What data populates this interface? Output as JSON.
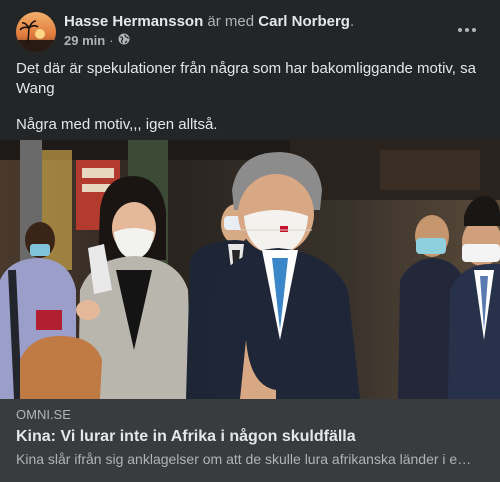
{
  "post": {
    "author": "Hasse Hermansson",
    "with_text": "är med",
    "tagged": "Carl Norberg",
    "tagged_suffix": ".",
    "time": "29 min",
    "separator": "·",
    "audience_icon": "globe-icon",
    "more_icon": "more-horizontal-icon",
    "text_lines": [
      "Det där är spekulationer från några som har bakomliggande motiv, sa Wang",
      "Några med motiv,,, igen alltså."
    ]
  },
  "link_preview": {
    "domain": "OMNI.SE",
    "title": "Kina: Vi lurar inte in Afrika i någon skuldfälla",
    "description": "Kina slår ifrån sig anklagelser om att de skulle lura afrikanska länder i en skuldfälla."
  },
  "colors": {
    "background": "#242526",
    "link_box": "#3a3b3c",
    "text_primary": "#e4e6eb",
    "text_secondary": "#b0b3b8"
  }
}
